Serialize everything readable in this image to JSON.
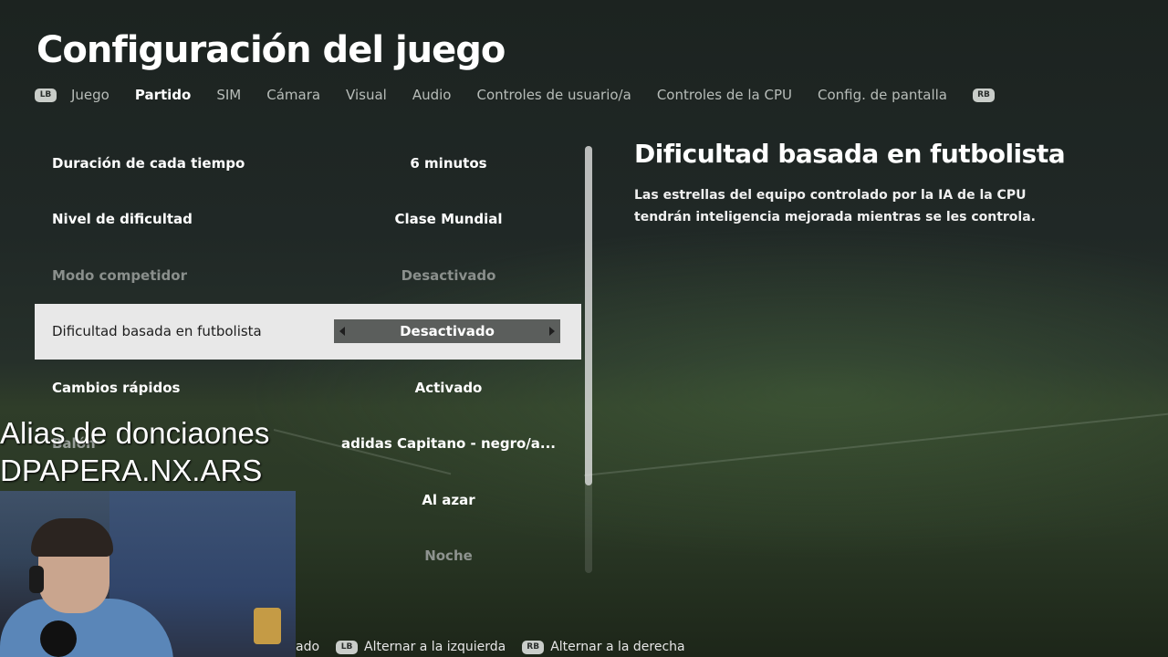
{
  "page": {
    "title": "Configuración del juego"
  },
  "tabs": {
    "left_button": "LB",
    "right_button": "RB",
    "items": [
      "Juego",
      "Partido",
      "SIM",
      "Cámara",
      "Visual",
      "Audio",
      "Controles de usuario/a",
      "Controles de la CPU",
      "Config. de pantalla"
    ],
    "active": "Partido"
  },
  "settings": [
    {
      "label": "Duración de cada tiempo",
      "value": "6 minutos"
    },
    {
      "label": "Nivel de dificultad",
      "value": "Clase Mundial"
    },
    {
      "label": "Modo competidor",
      "value": "Desactivado"
    },
    {
      "label": "Dificultad basada en futbolista",
      "value": "Desactivado"
    },
    {
      "label": "Cambios rápidos",
      "value": "Activado"
    },
    {
      "label": "Balón",
      "value": "adidas Capitano - negro/a..."
    },
    {
      "label": "",
      "value": "Al azar"
    },
    {
      "label": "",
      "value": "Noche"
    }
  ],
  "selected_setting_index": 3,
  "detail": {
    "title": "Dificultad basada en futbolista",
    "description": "Las estrellas del equipo controlado por la IA de la CPU tendrán inteligencia mejorada mientras se les controla."
  },
  "stream_overlay": {
    "line1": "Alias de donciaones",
    "line2": "DPAPERA.NX.ARS"
  },
  "footer_hints": {
    "partial": "ado",
    "lb_button": "LB",
    "lb_action": "Alternar a la izquierda",
    "rb_button": "RB",
    "rb_action": "Alternar a la derecha"
  }
}
